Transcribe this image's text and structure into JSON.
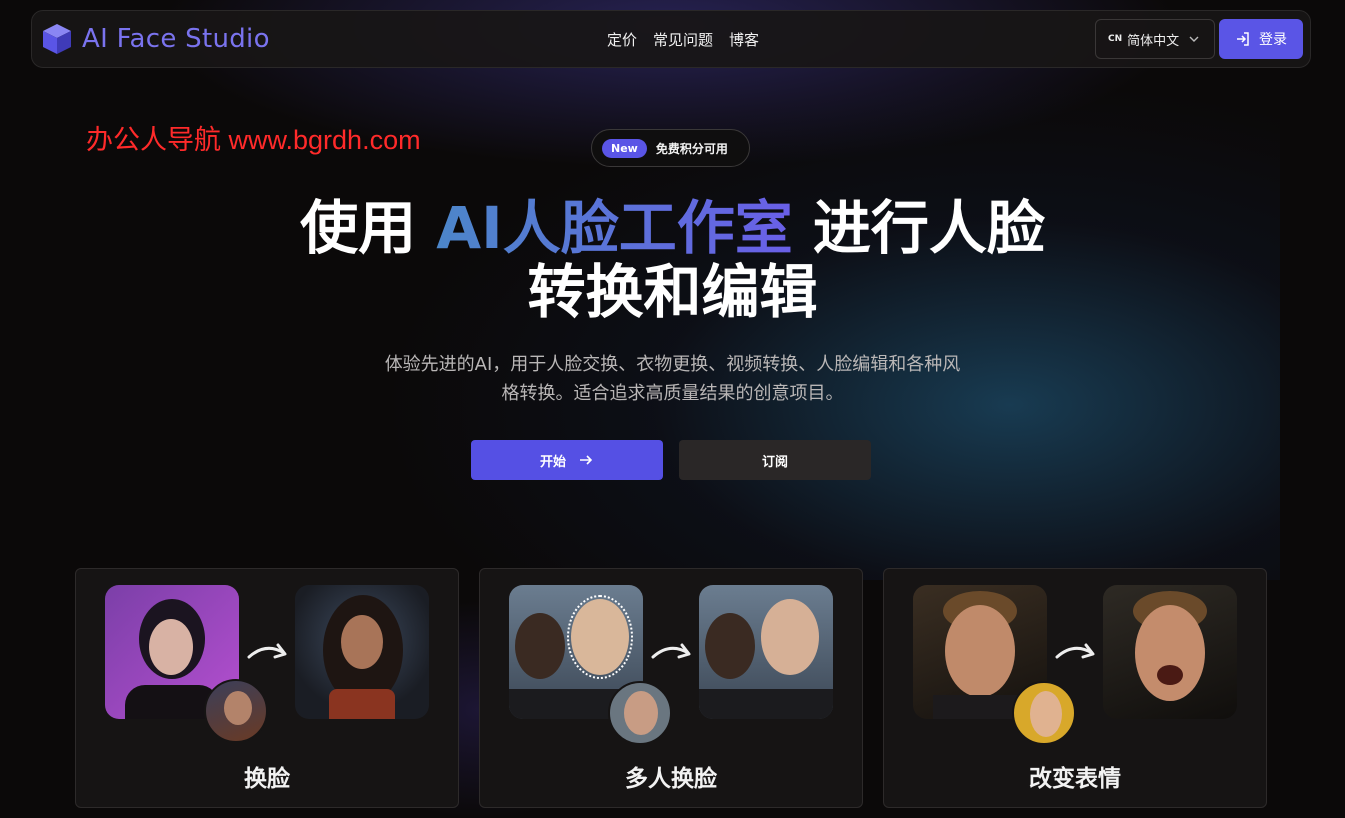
{
  "brand": {
    "name": "AI Face Studio"
  },
  "nav": {
    "links": [
      "定价",
      "常见问题",
      "博客"
    ],
    "lang_code": "CN",
    "lang_label": "简体中文",
    "login_label": "登录"
  },
  "watermark": "办公人导航 www.bgrdh.com",
  "badge": {
    "tag": "New",
    "text": "免费积分可用"
  },
  "hero": {
    "title_part1": "使用 ",
    "title_accent": "AI人脸工作室",
    "title_part2": " 进行人脸",
    "title_line2": "转换和编辑",
    "subtitle_line1": "体验先进的AI，用于人脸交换、衣物更换、视频转换、人脸编辑和各种风",
    "subtitle_line2": "格转换。适合追求高质量结果的创意项目。",
    "start_label": "开始",
    "subscribe_label": "订阅"
  },
  "features": [
    {
      "title": "换脸"
    },
    {
      "title": "多人换脸"
    },
    {
      "title": "改变表情"
    }
  ],
  "colors": {
    "accent": "#5a55e6",
    "background": "#0b0909",
    "watermark": "#ff2a2a"
  }
}
